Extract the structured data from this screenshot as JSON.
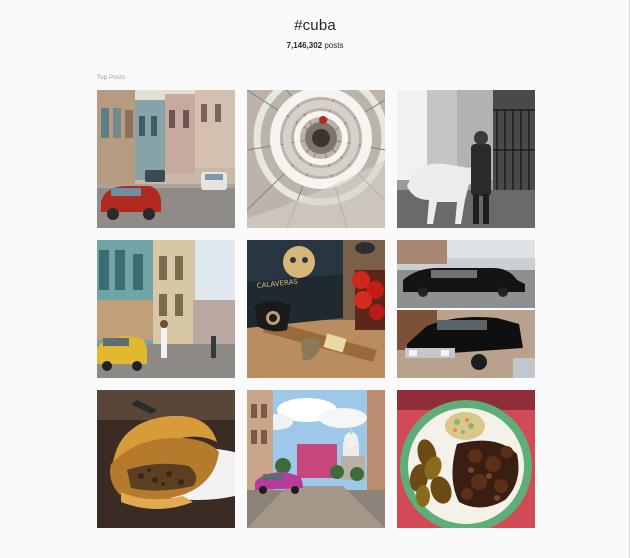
{
  "hashtag": {
    "title": "#cuba",
    "count_value": "7,146,302",
    "count_unit": "posts"
  },
  "top_posts_label": "Top Posts",
  "posts": [
    {
      "subject": "old-havana-street-red-car"
    },
    {
      "subject": "spiral-staircase"
    },
    {
      "subject": "man-with-white-horse-bw"
    },
    {
      "subject": "colorful-street-yellow-taxi"
    },
    {
      "subject": "cigars-and-strawberries",
      "box_text": "CALAVERAS"
    },
    {
      "subject": "black-classic-cadillac-collage"
    },
    {
      "subject": "cuban-empanada"
    },
    {
      "subject": "havana-capitol-pink-car"
    },
    {
      "subject": "stew-with-plantains"
    }
  ]
}
